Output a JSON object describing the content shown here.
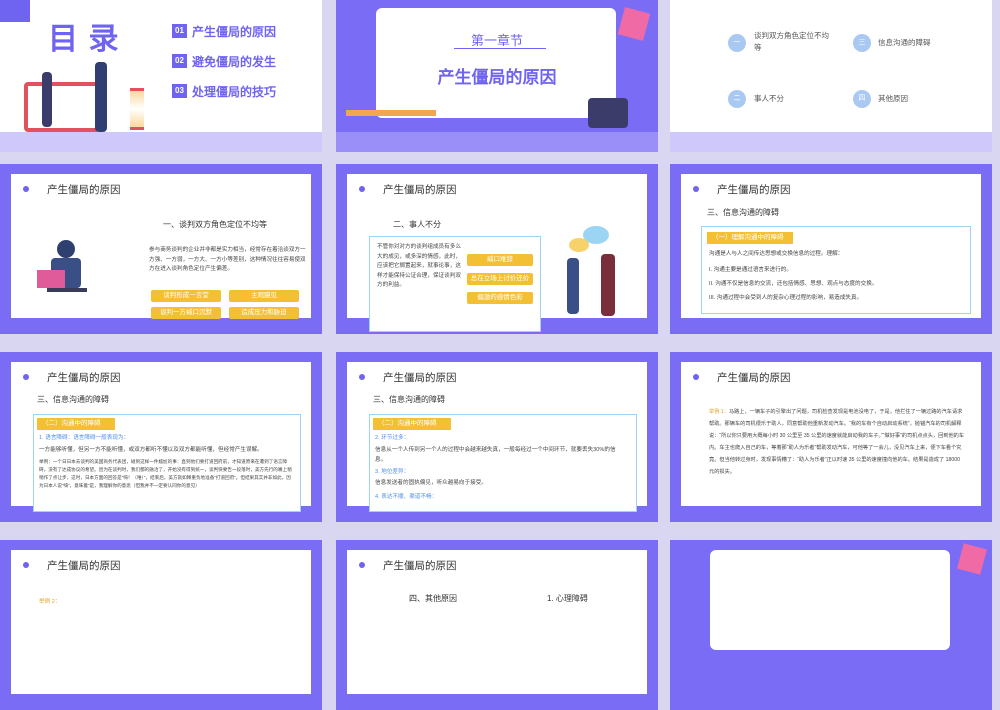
{
  "s1": {
    "title": "目 录",
    "items": [
      {
        "num": "01",
        "label": "产生僵局的原因"
      },
      {
        "num": "02",
        "label": "避免僵局的发生"
      },
      {
        "num": "03",
        "label": "处理僵局的技巧"
      }
    ]
  },
  "s2": {
    "chapter": "第一章节",
    "heading": "产生僵局的原因"
  },
  "s3": {
    "items": [
      {
        "num": "一",
        "label": "谈判双方角色定位不均等"
      },
      {
        "num": "三",
        "label": "信息沟通的障碍"
      },
      {
        "num": "二",
        "label": "事人不分"
      },
      {
        "num": "四",
        "label": "其他原因"
      }
    ]
  },
  "header": "产生僵局的原因",
  "s4": {
    "sub": "一、谈判双方角色定位不均等",
    "body": "参与商务谈判的企业并非都是实力相当，经常存在着洽谈双方一方强、一方弱，一方大、一方小等差别，这种情况往往容易使双方在进入谈判角色定位产生偏差。",
    "tags": [
      "谈判形成一言堂",
      "主观臆见",
      "谈判一方缄口沉默",
      "造成压力和胁迫"
    ]
  },
  "s5": {
    "sub": "二、事人不分",
    "body": "不管你对对方的谈判组成员有多么大的成见，或多深的情感，此时，应该把它搁置起来，就事论事，这样才能保持公证合理，保证谈判双方的利益。",
    "tags": [
      "缄口难辞",
      "总在立场上讨价还价",
      "偏激的感情色彩"
    ]
  },
  "s6": {
    "sub": "三、信息沟通的障碍",
    "section": "（一）理解沟通中的障碍",
    "intro": "沟通是人与人之间传达思想或交换信息的过程。理解：",
    "lines": [
      "I.   沟通主要是通过语言来进行的。",
      "II.  沟通不仅是信息的交流，还包括情感、思想、观点与态度的交换。",
      "III. 沟通过程中会受到人的复杂心理过程的影响，易造成失真。"
    ]
  },
  "s7": {
    "sub": "三、信息沟通的障碍",
    "section": "（二）沟通中的障碍",
    "point": "1. 语言障碍：语言障碍一般表现为：",
    "line1": "一方能够听懂，但另一方不能听懂，或双方都听不懂以及双方都能听懂，但经常产生误解。",
    "case": "举例：一个日日本去谈判的美国商务代表团，碰到这样一件尴尬的事：直到他们要打道回府前，才知道原来在遭到了语言障碍，没有了达成协议的希望。因为在谈判时，我们都的融洽了，开始没有得到统一，谈判快要告一段落时，美方先行的嘴上稍稍作了点让步，这时，日本方面的回答是“嗨！（唯）”，结束后，美方就如释重负地准备“打道回府”。但结果其实并非如此，因为日本人说“嗨”，意味着“是，我理解你的意思（但我并不一定要认同你的意见）"
  },
  "s8": {
    "sub": "三、信息沟通的障碍",
    "section": "（二）沟通中的障碍",
    "p1": "2. 环节过多：",
    "l1": "信息从一个人传到另一个人的过程中会越来越失真，一般每经过一个中间环节，就要丢失30%的信息。",
    "p2": "3. 地位差异：",
    "l2": "信息发送者的固执偏见，听众越易向于接受。",
    "p3": "4. 表达不顺、渠道不畅："
  },
  "s9": {
    "label": "举例 1：",
    "body": "马路上，一辆车子的引擎出了问题，司机检查发现是电池没电了，于是，他拦住了一辆过路的汽车请求帮助。那辆车的司机很乐于助人，同意帮助他重新发动汽车。“我的车有个自动启动系统”，抛锚汽车的司机解释说：“所以你只要用大概每小时 30 公里至 35 公里的速度就能启动我的车子。”“做好事”的司机点点头，回到他的车内。车主也爬入自己的车，等着那“助人为乐者”帮助发动汽车，可他等了一会儿，没见汽车上来，便下车看个究竟。但当他转过身时，发现事情糟了：“助人为乐者”正以时速 35 公里的速度撞向他的车。结果是造成了 18000 元的损失。"
  },
  "s10": {
    "label": "举例 2："
  },
  "s11": {
    "sub": "四、其他原因",
    "sub2": "1. 心理障碍"
  },
  "colors": {
    "accent": "#6f64f2",
    "bg": "#7b6cf6",
    "tag": "#f4c033",
    "border": "#9fd3f0"
  }
}
